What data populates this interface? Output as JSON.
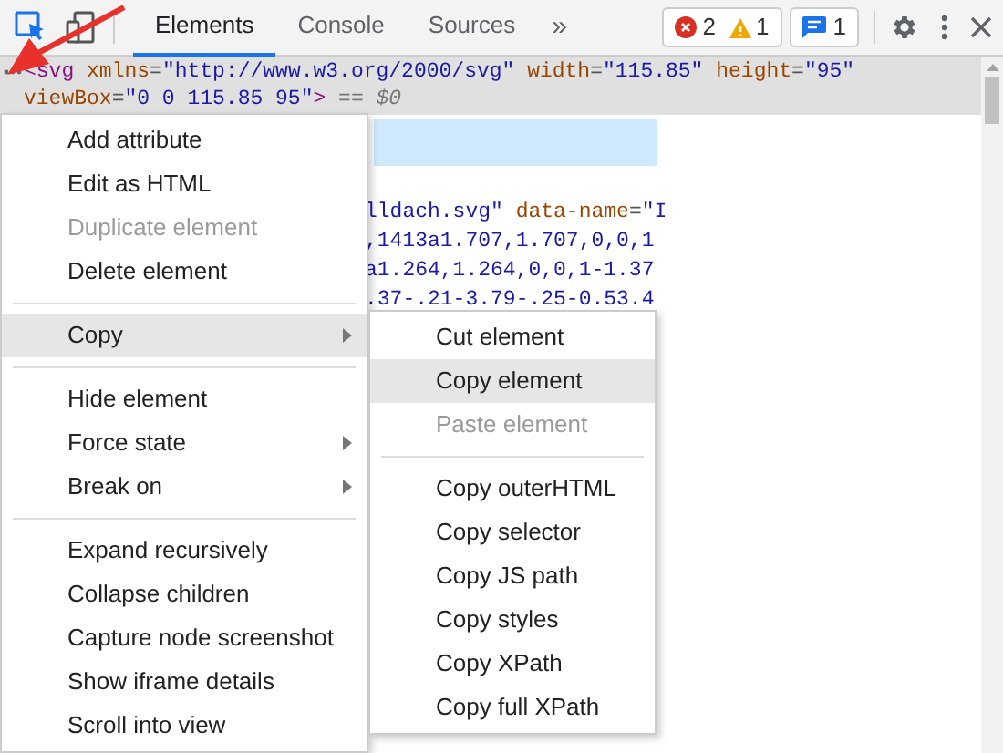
{
  "tabs": [
    {
      "label": "Elements",
      "selected": true
    },
    {
      "label": "Console",
      "selected": false
    },
    {
      "label": "Sources",
      "selected": false
    }
  ],
  "more_tabs": "»",
  "issue_counts": {
    "errors": "2",
    "warnings": "1",
    "messages": "1"
  },
  "selected_node": {
    "tokens": [
      {
        "kind": "tag",
        "text": "<svg"
      },
      {
        "kind": "attr",
        "text": " xmlns"
      },
      {
        "kind": "punct",
        "text": "="
      },
      {
        "kind": "value",
        "text": "\"http://www.w3.org/2000/svg\""
      },
      {
        "kind": "attr",
        "text": " width"
      },
      {
        "kind": "punct",
        "text": "="
      },
      {
        "kind": "value",
        "text": "\"115.85\""
      },
      {
        "kind": "attr",
        "text": " height"
      },
      {
        "kind": "punct",
        "text": "="
      },
      {
        "kind": "value",
        "text": "\"95\""
      },
      {
        "kind": "attr",
        "text": " viewBox"
      },
      {
        "kind": "punct",
        "text": "="
      },
      {
        "kind": "value",
        "text": "\"0 0 115.85 95\""
      },
      {
        "kind": "tag",
        "text": ">"
      },
      {
        "kind": "note",
        "text": " == $0"
      }
    ]
  },
  "code_lines": [
    {
      "tokens": [
        {
          "kind": "value",
          "text": "lldach.svg\""
        },
        {
          "kind": "attr",
          "text": " data-name"
        },
        {
          "kind": "punct",
          "text": "="
        },
        {
          "kind": "value",
          "text": "\"I"
        }
      ]
    },
    {
      "tokens": [
        {
          "kind": "value",
          "text": ",1413a1.707,1.707,0,0,1"
        }
      ]
    },
    {
      "tokens": [
        {
          "kind": "value",
          "text": "a1.264,1.264,0,0,1-1.37"
        }
      ]
    },
    {
      "tokens": [
        {
          "kind": "value",
          "text": ".37-.21-3.79-.25-0.53.4"
        }
      ]
    }
  ],
  "context_menu": [
    {
      "kind": "item",
      "label": "Add attribute",
      "disabled": false,
      "highlighted": false,
      "submenu": false
    },
    {
      "kind": "item",
      "label": "Edit as HTML",
      "disabled": false,
      "highlighted": false,
      "submenu": false
    },
    {
      "kind": "item",
      "label": "Duplicate element",
      "disabled": true,
      "highlighted": false,
      "submenu": false
    },
    {
      "kind": "item",
      "label": "Delete element",
      "disabled": false,
      "highlighted": false,
      "submenu": false
    },
    {
      "kind": "separator"
    },
    {
      "kind": "item",
      "label": "Copy",
      "disabled": false,
      "highlighted": true,
      "submenu": true
    },
    {
      "kind": "separator"
    },
    {
      "kind": "item",
      "label": "Hide element",
      "disabled": false,
      "highlighted": false,
      "submenu": false
    },
    {
      "kind": "item",
      "label": "Force state",
      "disabled": false,
      "highlighted": false,
      "submenu": true
    },
    {
      "kind": "item",
      "label": "Break on",
      "disabled": false,
      "highlighted": false,
      "submenu": true
    },
    {
      "kind": "separator"
    },
    {
      "kind": "item",
      "label": "Expand recursively",
      "disabled": false,
      "highlighted": false,
      "submenu": false
    },
    {
      "kind": "item",
      "label": "Collapse children",
      "disabled": false,
      "highlighted": false,
      "submenu": false
    },
    {
      "kind": "item",
      "label": "Capture node screenshot",
      "disabled": false,
      "highlighted": false,
      "submenu": false
    },
    {
      "kind": "item",
      "label": "Show iframe details",
      "disabled": false,
      "highlighted": false,
      "submenu": false
    },
    {
      "kind": "item",
      "label": "Scroll into view",
      "disabled": false,
      "highlighted": false,
      "submenu": false
    }
  ],
  "copy_submenu": [
    {
      "kind": "item",
      "label": "Cut element",
      "disabled": false,
      "highlighted": false
    },
    {
      "kind": "item",
      "label": "Copy element",
      "disabled": false,
      "highlighted": true
    },
    {
      "kind": "item",
      "label": "Paste element",
      "disabled": true,
      "highlighted": false
    },
    {
      "kind": "separator"
    },
    {
      "kind": "item",
      "label": "Copy outerHTML",
      "disabled": false,
      "highlighted": false
    },
    {
      "kind": "item",
      "label": "Copy selector",
      "disabled": false,
      "highlighted": false
    },
    {
      "kind": "item",
      "label": "Copy JS path",
      "disabled": false,
      "highlighted": false
    },
    {
      "kind": "item",
      "label": "Copy styles",
      "disabled": false,
      "highlighted": false
    },
    {
      "kind": "item",
      "label": "Copy XPath",
      "disabled": false,
      "highlighted": false
    },
    {
      "kind": "item",
      "label": "Copy full XPath",
      "disabled": false,
      "highlighted": false
    }
  ]
}
